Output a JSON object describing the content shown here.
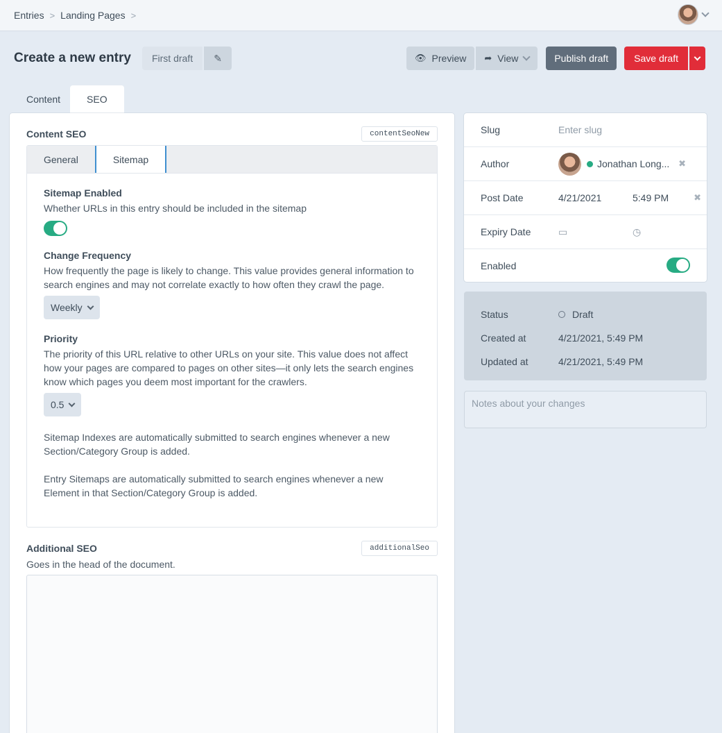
{
  "breadcrumb": {
    "items": [
      "Entries",
      "Landing Pages"
    ]
  },
  "header": {
    "title": "Create a new entry",
    "draft_name": "First draft",
    "preview_label": "Preview",
    "view_label": "View",
    "publish_label": "Publish draft",
    "save_label": "Save draft"
  },
  "tabs": {
    "content": "Content",
    "seo": "SEO"
  },
  "content_seo": {
    "title": "Content SEO",
    "handle": "contentSeoNew",
    "tabs": {
      "general": "General",
      "sitemap": "Sitemap"
    },
    "sitemap_enabled": {
      "label": "Sitemap Enabled",
      "desc": "Whether URLs in this entry should be included in the sitemap",
      "on": true
    },
    "change_frequency": {
      "label": "Change Frequency",
      "desc": "How frequently the page is likely to change. This value provides general information to search engines and may not correlate exactly to how often they crawl the page.",
      "value": "Weekly"
    },
    "priority": {
      "label": "Priority",
      "desc": "The priority of this URL relative to other URLs on your site. This value does not affect how your pages are compared to pages on other sites—it only lets the search engines know which pages you deem most important for the crawlers.",
      "value": "0.5"
    },
    "note1": "Sitemap Indexes are automatically submitted to search engines whenever a new Section/Category Group is added.",
    "note2": "Entry Sitemaps are automatically submitted to search engines whenever a new Element in that Section/Category Group is added."
  },
  "additional_seo": {
    "title": "Additional SEO",
    "handle": "additionalSeo",
    "desc": "Goes in the head of the document."
  },
  "meta": {
    "slug_label": "Slug",
    "slug_placeholder": "Enter slug",
    "author_label": "Author",
    "author_name": "Jonathan Long...",
    "post_date_label": "Post Date",
    "post_date": "4/21/2021",
    "post_time": "5:49 PM",
    "expiry_label": "Expiry Date",
    "enabled_label": "Enabled"
  },
  "status": {
    "status_label": "Status",
    "status_value": "Draft",
    "created_label": "Created at",
    "created_value": "4/21/2021, 5:49 PM",
    "updated_label": "Updated at",
    "updated_value": "4/21/2021, 5:49 PM"
  },
  "notes": {
    "placeholder": "Notes about your changes"
  },
  "colors": {
    "accent_green": "#27ab83",
    "danger": "#e12d39",
    "tab_accent": "#3f8fd0"
  },
  "icons": [
    "chevron-right-icon",
    "edit-pencil-icon",
    "eye-icon",
    "share-arrow-icon",
    "chevron-down-icon",
    "calendar-icon",
    "clock-icon",
    "close-icon"
  ]
}
